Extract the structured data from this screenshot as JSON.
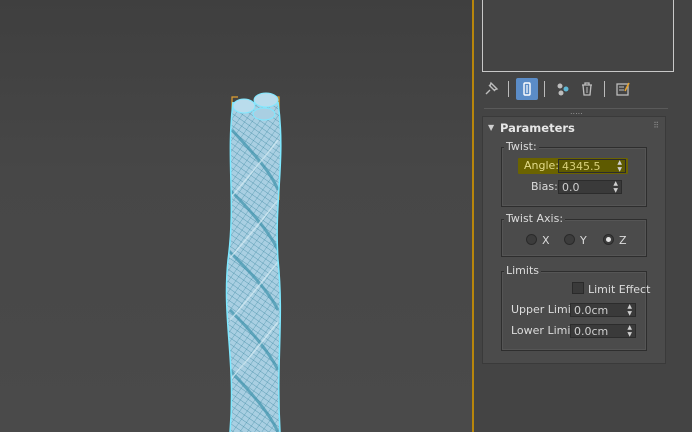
{
  "app": {
    "name": "Twist modifier panel"
  },
  "colors": {
    "viewport_bg": "#444444",
    "wire": "#7ed8ee",
    "wire_fill": "#a9cfe2",
    "selection_bracket": "#e0a030",
    "highlight_field": "#6b6300",
    "active_button": "#5b8cc7"
  },
  "toolbar": {
    "items": [
      {
        "icon": "pin-stack-icon"
      },
      {
        "icon": "show-end-result-icon",
        "active": true
      },
      {
        "icon": "make-unique-icon"
      },
      {
        "icon": "remove-modifier-icon"
      },
      {
        "icon": "configure-sets-icon"
      }
    ],
    "grip": "....."
  },
  "rollout": {
    "title": "Parameters",
    "twist": {
      "group_label": "Twist:",
      "angle_label": "Angle:",
      "angle_value": "4345.5",
      "bias_label": "Bias:",
      "bias_value": "0.0"
    },
    "twist_axis": {
      "group_label": "Twist Axis:",
      "options": [
        {
          "label": "X",
          "selected": false
        },
        {
          "label": "Y",
          "selected": false
        },
        {
          "label": "Z",
          "selected": true
        }
      ]
    },
    "limits": {
      "group_label": "Limits",
      "limit_effect_label": "Limit Effect",
      "upper_label": "Upper Limit:",
      "upper_value": "0.0cm",
      "lower_label": "Lower Limit:",
      "lower_value": "0.0cm"
    }
  }
}
